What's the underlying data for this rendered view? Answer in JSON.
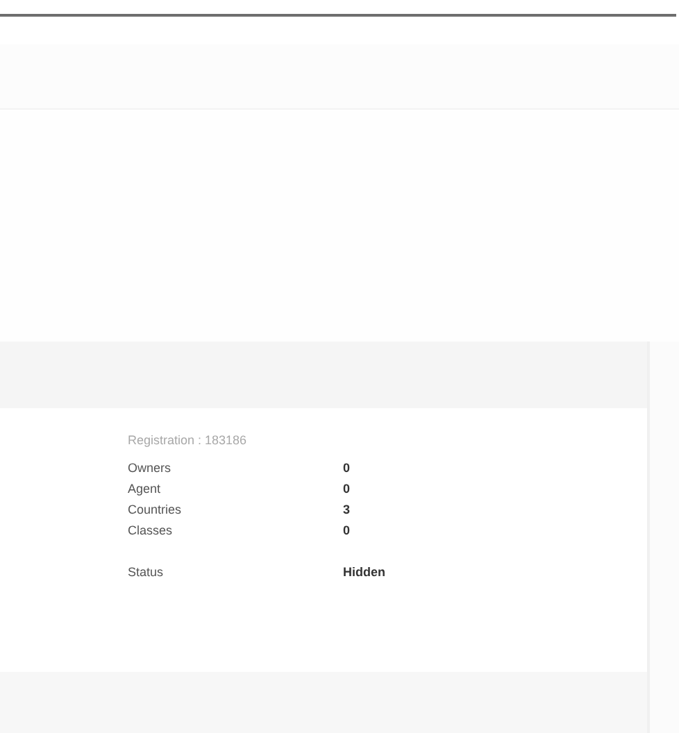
{
  "registration": "Registration : 183186",
  "stats": [
    {
      "label": "Owners",
      "value": "0"
    },
    {
      "label": "Agent",
      "value": "0"
    },
    {
      "label": "Countries",
      "value": "3"
    },
    {
      "label": "Classes",
      "value": "0"
    }
  ],
  "status": {
    "label": "Status",
    "value": "Hidden"
  }
}
